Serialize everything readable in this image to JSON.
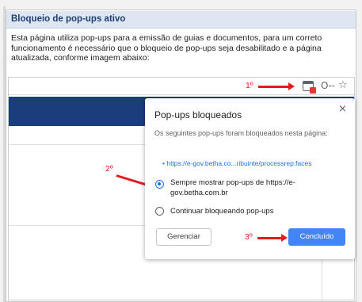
{
  "dialog": {
    "title": "Bloqueio de pop-ups ativo",
    "message": "Esta página utiliza pop-ups para a emissão de guias e documentos, para um correto funcionamento é necessário que o bloqueio de pop-ups seja desabilitado e a página atualizada, conforme imagem abaixo:"
  },
  "toolbar": {
    "icons": [
      "popup-blocked-icon",
      "key-icon",
      "star-icon"
    ],
    "key_glyph": "O‑‑",
    "star_glyph": "☆"
  },
  "annotations": {
    "step1": "1º",
    "step2": "2º",
    "step3": "3º",
    "arrow_color": "#e31c1c"
  },
  "popup": {
    "title": "Pop-ups bloqueados",
    "close_glyph": "×",
    "description": "Os seguintes pop-ups foram bloqueados nesta página:",
    "blocked_link": "• https://e-gov.betha.co...ribuinte/processrep.faces",
    "option_always": "Sempre mostrar pop-ups de https://e-gov.betha.com.br",
    "option_block": "Continuar bloqueando pop-ups",
    "manage_label": "Gerenciar",
    "done_label": "Concluído",
    "selected_option": "option_always"
  },
  "colors": {
    "header_band": "#1a3d7c",
    "primary_button": "#4285f4",
    "title_bar": "#dde6f2",
    "title_text": "#1f3f73"
  }
}
